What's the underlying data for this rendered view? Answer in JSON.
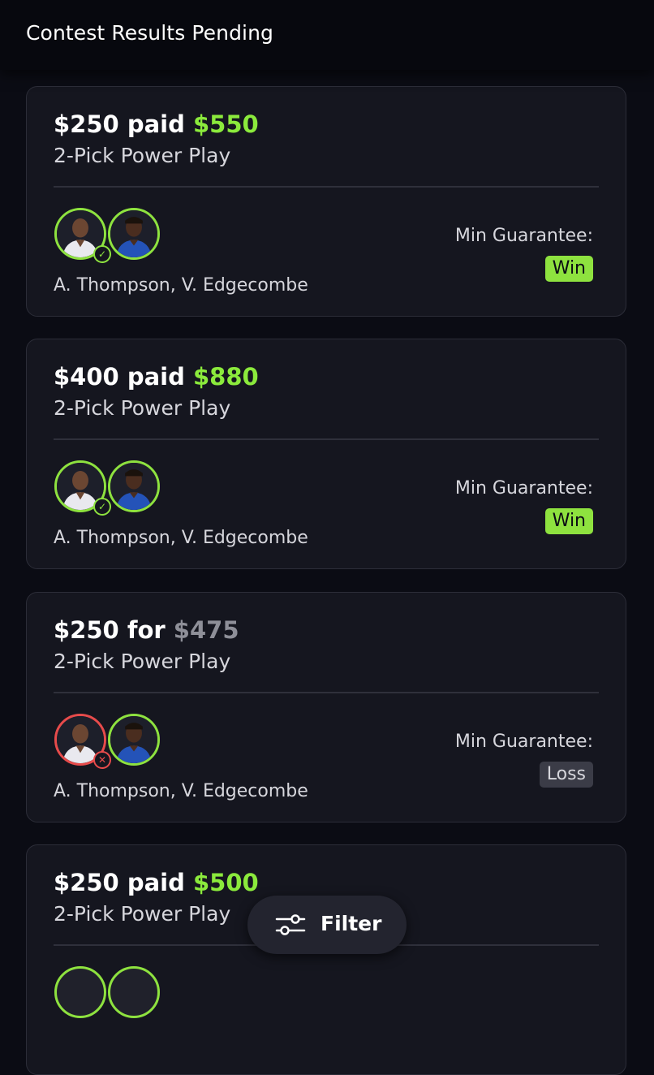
{
  "header": {
    "title": "Contest Results Pending"
  },
  "colors": {
    "win": "#8ee23f",
    "loss": "#e74b4b",
    "payout_green": "#8bea3c"
  },
  "cards": [
    {
      "entry": "$250",
      "verb": "paid",
      "payout": "$550",
      "payout_style": "green",
      "type": "2-Pick Power Play",
      "players": "A. Thompson, V. Edgecombe",
      "mg_label": "Min Guarantee:",
      "mg_value": "Win",
      "first_pick_status": "check-icon"
    },
    {
      "entry": "$400",
      "verb": "paid",
      "payout": "$880",
      "payout_style": "green",
      "type": "2-Pick Power Play",
      "players": "A. Thompson, V. Edgecombe",
      "mg_label": "Min Guarantee:",
      "mg_value": "Win",
      "first_pick_status": "check-icon"
    },
    {
      "entry": "$250",
      "verb": "for",
      "payout": "$475",
      "payout_style": "gray",
      "type": "2-Pick Power Play",
      "players": "A. Thompson, V. Edgecombe",
      "mg_label": "Min Guarantee:",
      "mg_value": "Loss",
      "first_pick_status": "x-icon"
    },
    {
      "entry": "$250",
      "verb": "paid",
      "payout": "$500",
      "payout_style": "green",
      "type": "2-Pick Power Play"
    }
  ],
  "filter": {
    "label": "Filter",
    "icon": "sliders-icon"
  }
}
